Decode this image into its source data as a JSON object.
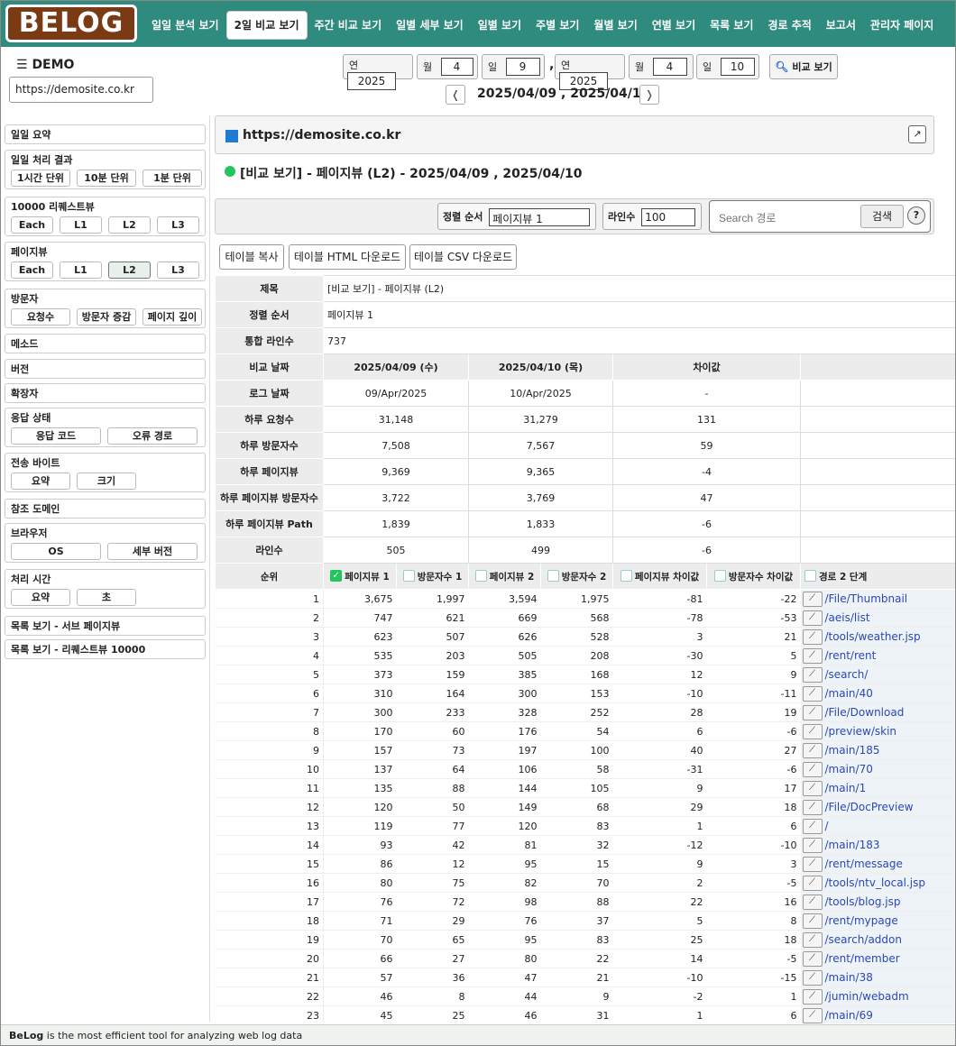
{
  "logo": "BELOG",
  "nav": [
    {
      "label": "일일 분석 보기",
      "active": false
    },
    {
      "label": "2일 비교 보기",
      "active": true
    },
    {
      "label": "주간 비교 보기",
      "active": false
    },
    {
      "label": "일별 세부 보기",
      "active": false
    },
    {
      "label": "일별 보기",
      "active": false
    },
    {
      "label": "주별 보기",
      "active": false
    },
    {
      "label": "월별 보기",
      "active": false
    },
    {
      "label": "연별 보기",
      "active": false
    },
    {
      "label": "목록 보기",
      "active": false
    },
    {
      "label": "경로 추적",
      "active": false
    },
    {
      "label": "보고서",
      "active": false
    },
    {
      "label": "관리자 페이지",
      "active": false
    }
  ],
  "site": {
    "menu_icon": "☰",
    "name": "DEMO",
    "url": "https://demosite.co.kr"
  },
  "date_from": {
    "year_label": "연",
    "year": "2025",
    "month_label": "월",
    "month": "4",
    "day_label": "일",
    "day": "9"
  },
  "date_to": {
    "year_label": "연",
    "year": "2025",
    "month_label": "월",
    "month": "4",
    "day_label": "일",
    "day": "10"
  },
  "date_sep": ",",
  "compare_button": "비교 보기",
  "prev_arrow": "❬",
  "next_arrow": "❭",
  "range_text": "2025/04/09 , 2025/04/10",
  "sidebar": [
    {
      "title": "일일 요약",
      "buttons": []
    },
    {
      "title": "일일 처리 결과",
      "buttons": [
        {
          "label": "1시간 단위"
        },
        {
          "label": "10분 단위"
        },
        {
          "label": "1분 단위"
        }
      ]
    },
    {
      "title": "10000 리퀘스트뷰",
      "buttons": [
        {
          "label": "Each"
        },
        {
          "label": "L1"
        },
        {
          "label": "L2"
        },
        {
          "label": "L3"
        }
      ]
    },
    {
      "title": "페이지뷰",
      "buttons": [
        {
          "label": "Each"
        },
        {
          "label": "L1"
        },
        {
          "label": "L2",
          "selected": true
        },
        {
          "label": "L3"
        }
      ]
    },
    {
      "title": "방문자",
      "buttons": [
        {
          "label": "요청수"
        },
        {
          "label": "방문자 증감"
        },
        {
          "label": "페이지 깊이"
        }
      ]
    },
    {
      "title": "메소드",
      "buttons": []
    },
    {
      "title": "버전",
      "buttons": []
    },
    {
      "title": "확장자",
      "buttons": []
    },
    {
      "title": "응답 상태",
      "buttons": [
        {
          "label": "응답 코드"
        },
        {
          "label": "오류 경로"
        }
      ]
    },
    {
      "title": "전송 바이트",
      "buttons": [
        {
          "label": "요약"
        },
        {
          "label": "크기"
        }
      ]
    },
    {
      "title": "참조 도메인",
      "buttons": []
    },
    {
      "title": "브라우저",
      "buttons": [
        {
          "label": "OS"
        },
        {
          "label": "세부 버전"
        }
      ]
    },
    {
      "title": "처리 시간",
      "buttons": [
        {
          "label": "요약"
        },
        {
          "label": "초"
        }
      ]
    },
    {
      "title": "목록 보기 - 서브 페이지뷰",
      "buttons": []
    },
    {
      "title": "목록 보기 - 리퀘스트뷰 10000",
      "buttons": []
    }
  ],
  "main": {
    "site_title": "https://demosite.co.kr",
    "ext_icon": "↗",
    "report_title": "[비교 보기] - 페이지뷰 (L2) - 2025/04/09 , 2025/04/10",
    "sort_label": "정렬 순서",
    "sort_value": "페이지뷰 1",
    "lines_label": "라인수",
    "lines_value": "100",
    "search_placeholder": "Search 경로",
    "search_button": "검색",
    "help": "?",
    "copy_button": "테이블 복사",
    "html_button": "테이블 HTML 다운로드",
    "csv_button": "테이블 CSV 다운로드"
  },
  "info": {
    "title_label": "제목",
    "title_value": "[비교 보기] - 페이지뷰 (L2)",
    "sort_label": "정렬 순서",
    "sort_value": "페이지뷰 1",
    "total_label": "통합 라인수",
    "total_value": "737"
  },
  "compare": {
    "header": {
      "label": "비교 날짜",
      "d1": "2025/04/09 (수)",
      "d2": "2025/04/10 (목)",
      "diff": "차이값"
    },
    "rows": [
      {
        "label": "로그 날짜",
        "d1": "09/Apr/2025",
        "d2": "10/Apr/2025",
        "diff": "-"
      },
      {
        "label": "하루 요청수",
        "d1": "31,148",
        "d2": "31,279",
        "diff": "131"
      },
      {
        "label": "하루 방문자수",
        "d1": "7,508",
        "d2": "7,567",
        "diff": "59"
      },
      {
        "label": "하루 페이지뷰",
        "d1": "9,369",
        "d2": "9,365",
        "diff": "-4"
      },
      {
        "label": "하루 페이지뷰 방문자수",
        "d1": "3,722",
        "d2": "3,769",
        "diff": "47"
      },
      {
        "label": "하루 페이지뷰 Path",
        "d1": "1,839",
        "d2": "1,833",
        "diff": "-6"
      },
      {
        "label": "라인수",
        "d1": "505",
        "d2": "499",
        "diff": "-6"
      }
    ]
  },
  "columns": {
    "rank": "순위",
    "pv1": "페이지뷰 1",
    "pv1_checked": true,
    "vis1": "방문자수 1",
    "pv2": "페이지뷰 2",
    "vis2": "방문자수 2",
    "pvdiff": "페이지뷰 차이값",
    "visdiff": "방문자수 차이값",
    "path": "경로 2 단계",
    "check_mark": "✓",
    "chart_icon": "📈"
  },
  "rows": [
    {
      "rank": "1",
      "pv1": "3,675",
      "vis1": "1,997",
      "pv2": "3,594",
      "vis2": "1,975",
      "pvdiff": "-81",
      "visdiff": "-22",
      "path": "/File/Thumbnail"
    },
    {
      "rank": "2",
      "pv1": "747",
      "vis1": "621",
      "pv2": "669",
      "vis2": "568",
      "pvdiff": "-78",
      "visdiff": "-53",
      "path": "/aeis/list"
    },
    {
      "rank": "3",
      "pv1": "623",
      "vis1": "507",
      "pv2": "626",
      "vis2": "528",
      "pvdiff": "3",
      "visdiff": "21",
      "path": "/tools/weather.jsp"
    },
    {
      "rank": "4",
      "pv1": "535",
      "vis1": "203",
      "pv2": "505",
      "vis2": "208",
      "pvdiff": "-30",
      "visdiff": "5",
      "path": "/rent/rent"
    },
    {
      "rank": "5",
      "pv1": "373",
      "vis1": "159",
      "pv2": "385",
      "vis2": "168",
      "pvdiff": "12",
      "visdiff": "9",
      "path": "/search/"
    },
    {
      "rank": "6",
      "pv1": "310",
      "vis1": "164",
      "pv2": "300",
      "vis2": "153",
      "pvdiff": "-10",
      "visdiff": "-11",
      "path": "/main/40"
    },
    {
      "rank": "7",
      "pv1": "300",
      "vis1": "233",
      "pv2": "328",
      "vis2": "252",
      "pvdiff": "28",
      "visdiff": "19",
      "path": "/File/Download"
    },
    {
      "rank": "8",
      "pv1": "170",
      "vis1": "60",
      "pv2": "176",
      "vis2": "54",
      "pvdiff": "6",
      "visdiff": "-6",
      "path": "/preview/skin"
    },
    {
      "rank": "9",
      "pv1": "157",
      "vis1": "73",
      "pv2": "197",
      "vis2": "100",
      "pvdiff": "40",
      "visdiff": "27",
      "path": "/main/185"
    },
    {
      "rank": "10",
      "pv1": "137",
      "vis1": "64",
      "pv2": "106",
      "vis2": "58",
      "pvdiff": "-31",
      "visdiff": "-6",
      "path": "/main/70"
    },
    {
      "rank": "11",
      "pv1": "135",
      "vis1": "88",
      "pv2": "144",
      "vis2": "105",
      "pvdiff": "9",
      "visdiff": "17",
      "path": "/main/1"
    },
    {
      "rank": "12",
      "pv1": "120",
      "vis1": "50",
      "pv2": "149",
      "vis2": "68",
      "pvdiff": "29",
      "visdiff": "18",
      "path": "/File/DocPreview"
    },
    {
      "rank": "13",
      "pv1": "119",
      "vis1": "77",
      "pv2": "120",
      "vis2": "83",
      "pvdiff": "1",
      "visdiff": "6",
      "path": "/"
    },
    {
      "rank": "14",
      "pv1": "93",
      "vis1": "42",
      "pv2": "81",
      "vis2": "32",
      "pvdiff": "-12",
      "visdiff": "-10",
      "path": "/main/183"
    },
    {
      "rank": "15",
      "pv1": "86",
      "vis1": "12",
      "pv2": "95",
      "vis2": "15",
      "pvdiff": "9",
      "visdiff": "3",
      "path": "/rent/message"
    },
    {
      "rank": "16",
      "pv1": "80",
      "vis1": "75",
      "pv2": "82",
      "vis2": "70",
      "pvdiff": "2",
      "visdiff": "-5",
      "path": "/tools/ntv_local.jsp"
    },
    {
      "rank": "17",
      "pv1": "76",
      "vis1": "72",
      "pv2": "98",
      "vis2": "88",
      "pvdiff": "22",
      "visdiff": "16",
      "path": "/tools/blog.jsp"
    },
    {
      "rank": "18",
      "pv1": "71",
      "vis1": "29",
      "pv2": "76",
      "vis2": "37",
      "pvdiff": "5",
      "visdiff": "8",
      "path": "/rent/mypage"
    },
    {
      "rank": "19",
      "pv1": "70",
      "vis1": "65",
      "pv2": "95",
      "vis2": "83",
      "pvdiff": "25",
      "visdiff": "18",
      "path": "/search/addon"
    },
    {
      "rank": "20",
      "pv1": "66",
      "vis1": "27",
      "pv2": "80",
      "vis2": "22",
      "pvdiff": "14",
      "visdiff": "-5",
      "path": "/rent/member"
    },
    {
      "rank": "21",
      "pv1": "57",
      "vis1": "36",
      "pv2": "47",
      "vis2": "21",
      "pvdiff": "-10",
      "visdiff": "-15",
      "path": "/main/38"
    },
    {
      "rank": "22",
      "pv1": "46",
      "vis1": "8",
      "pv2": "44",
      "vis2": "9",
      "pvdiff": "-2",
      "visdiff": "1",
      "path": "/jumin/webadm"
    },
    {
      "rank": "23",
      "pv1": "45",
      "vis1": "25",
      "pv2": "46",
      "vis2": "31",
      "pvdiff": "1",
      "visdiff": "6",
      "path": "/main/69"
    }
  ],
  "footer": {
    "brand": "BeLog",
    "text": " is the most efficient tool for analyzing web log data"
  },
  "colors": {
    "nav_bg": "#2e8b7d",
    "logo_bg": "#7a3a14",
    "link": "#2a48b8",
    "accent_green": "#22c55e",
    "site_square": "#1f7bd1"
  }
}
